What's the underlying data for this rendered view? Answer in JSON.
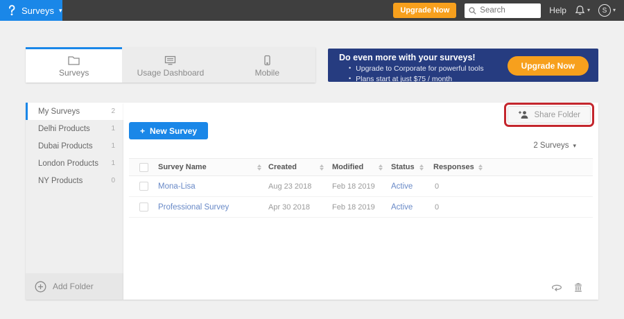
{
  "topbar": {
    "app_menu": "Surveys",
    "upgrade_label": "Upgrade Now",
    "search_placeholder": "Search",
    "help_label": "Help",
    "avatar_initial": "S"
  },
  "tabs": [
    {
      "label": "Surveys",
      "active": true
    },
    {
      "label": "Usage Dashboard",
      "active": false
    },
    {
      "label": "Mobile",
      "active": false
    }
  ],
  "banner": {
    "title": "Do even more with your surveys!",
    "bullets": [
      "Upgrade to Corporate for powerful tools",
      "Plans start at just $75 / month"
    ],
    "cta_label": "Upgrade Now"
  },
  "sidebar": {
    "folders": [
      {
        "name": "My Surveys",
        "count": "2",
        "active": true
      },
      {
        "name": "Delhi Products",
        "count": "1",
        "active": false
      },
      {
        "name": "Dubai Products",
        "count": "1",
        "active": false
      },
      {
        "name": "London Products",
        "count": "1",
        "active": false
      },
      {
        "name": "NY Products",
        "count": "0",
        "active": false
      }
    ],
    "add_folder_label": "Add Folder"
  },
  "main": {
    "share_folder_label": "Share Folder",
    "new_survey_label": "New Survey",
    "count_dropdown_label": "2 Surveys",
    "table": {
      "columns": [
        "Survey Name",
        "Created",
        "Modified",
        "Status",
        "Responses"
      ],
      "rows": [
        {
          "name": "Mona-Lisa",
          "created": "Aug 23 2018",
          "modified": "Feb 18 2019",
          "status": "Active",
          "responses": "0"
        },
        {
          "name": "Professional Survey",
          "created": "Apr 30 2018",
          "modified": "Feb 18 2019",
          "status": "Active",
          "responses": "0"
        }
      ]
    }
  },
  "icons": {
    "caret_down": "▾",
    "plus": "+",
    "bullet": "•"
  },
  "colors": {
    "accent-blue": "#1a87e8",
    "cta-orange": "#f7a01d",
    "banner-navy": "#263c80",
    "link-blue": "#6889c7",
    "annotation-red": "#c4262d",
    "topbar-dark": "#3f3f3f"
  }
}
